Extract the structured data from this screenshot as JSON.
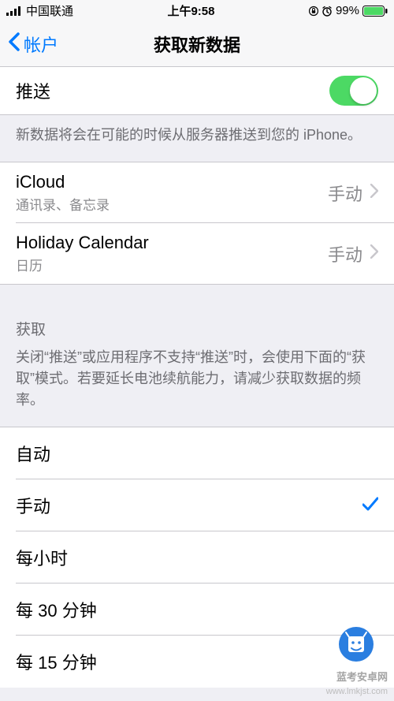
{
  "statusBar": {
    "carrier": "中国联通",
    "time": "上午9:58",
    "battery": "99%"
  },
  "nav": {
    "back": "帐户",
    "title": "获取新数据"
  },
  "push": {
    "label": "推送",
    "footer": "新数据将会在可能的时候从服务器推送到您的 iPhone。"
  },
  "accounts": [
    {
      "title": "iCloud",
      "subtitle": "通讯录、备忘录",
      "value": "手动"
    },
    {
      "title": "Holiday Calendar",
      "subtitle": "日历",
      "value": "手动"
    }
  ],
  "fetch": {
    "header": "获取",
    "footer": "关闭“推送”或应用程序不支持“推送”时，会使用下面的“获取”模式。若要延长电池续航能力，请减少获取数据的频率。",
    "options": [
      {
        "label": "自动",
        "selected": false
      },
      {
        "label": "手动",
        "selected": true
      },
      {
        "label": "每小时",
        "selected": false
      },
      {
        "label": "每 30 分钟",
        "selected": false
      },
      {
        "label": "每 15 分钟",
        "selected": false
      }
    ]
  },
  "watermark": {
    "name": "蓝考安卓网",
    "url": "www.lmkjst.com"
  }
}
